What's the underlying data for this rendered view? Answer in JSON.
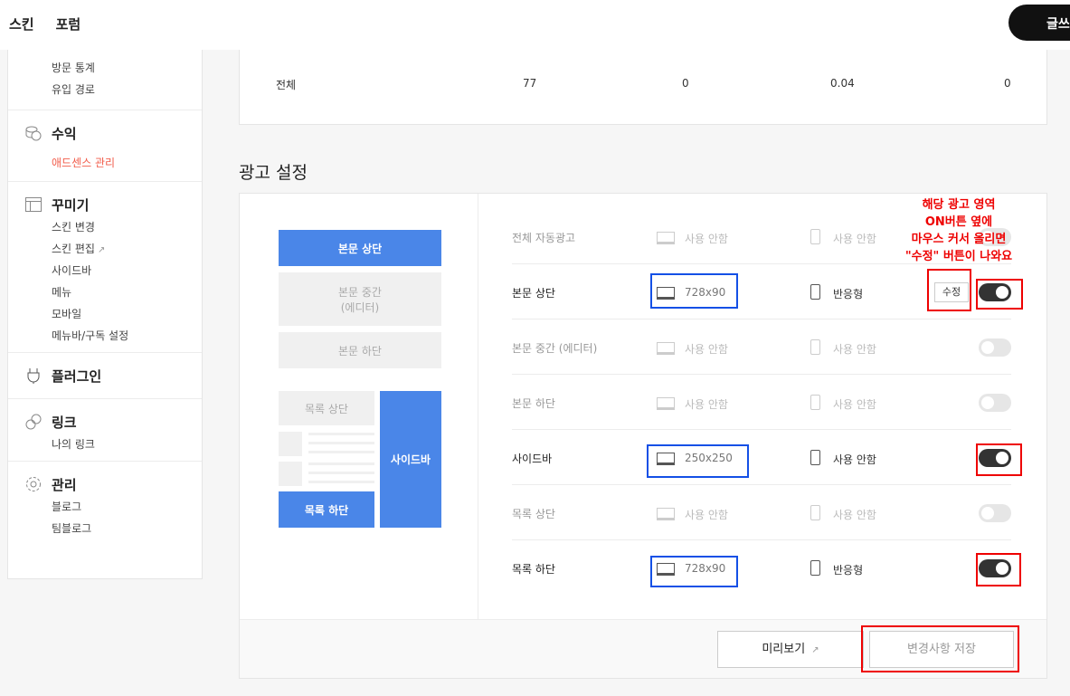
{
  "topbar": {
    "nav": [
      "스킨",
      "포럼"
    ],
    "write_label": "글쓰"
  },
  "sidebar": {
    "stats_items": [
      "방문 통계",
      "유입 경로"
    ],
    "revenue": {
      "title": "수익",
      "items": [
        "애드센스 관리"
      ]
    },
    "decorate": {
      "title": "꾸미기",
      "items": [
        "스킨 변경",
        "스킨 편집",
        "사이드바",
        "메뉴",
        "모바일",
        "메뉴바/구독 설정"
      ]
    },
    "plugin": {
      "title": "플러그인"
    },
    "link": {
      "title": "링크",
      "items": [
        "나의 링크"
      ]
    },
    "manage": {
      "title": "관리",
      "items": [
        "블로그",
        "팀블로그"
      ]
    }
  },
  "stats": {
    "row_label": "전체",
    "values": [
      "77",
      "0",
      "0.04",
      "0"
    ]
  },
  "ad_settings": {
    "title": "광고 설정",
    "preview": {
      "top": "본문 상단",
      "middle_l1": "본문 중간",
      "middle_l2": "(에디터)",
      "bottom": "본문 하단",
      "list_top": "목록 상단",
      "list_bottom": "목록 하단",
      "sidebar": "사이드바"
    },
    "rows": [
      {
        "name": "전체 자동광고",
        "pc": "사용 안함",
        "mobile": "사용 안함",
        "enabled": false
      },
      {
        "name": "본문 상단",
        "pc": "728x90",
        "mobile": "반응형",
        "enabled": true,
        "edit_label": "수정"
      },
      {
        "name": "본문 중간 (에디터)",
        "pc": "사용 안함",
        "mobile": "사용 안함",
        "enabled": false
      },
      {
        "name": "본문 하단",
        "pc": "사용 안함",
        "mobile": "사용 안함",
        "enabled": false
      },
      {
        "name": "사이드바",
        "pc": "250x250",
        "mobile": "사용 안함",
        "enabled": true
      },
      {
        "name": "목록 상단",
        "pc": "사용 안함",
        "mobile": "사용 안함",
        "enabled": false
      },
      {
        "name": "목록 하단",
        "pc": "728x90",
        "mobile": "반응형",
        "enabled": true
      }
    ],
    "preview_button": "미리보기",
    "save_button": "변경사항 저장"
  },
  "annotation": {
    "lines": [
      "해당 광고 영역",
      "ON버튼 옆에",
      "마우스 커서 올리면",
      "\"수정\" 버튼이 나와요"
    ],
    "color": "#ee0000"
  },
  "colors": {
    "accent": "#4a86e8",
    "red": "#f25d4b",
    "toggle_on": "#333333"
  }
}
